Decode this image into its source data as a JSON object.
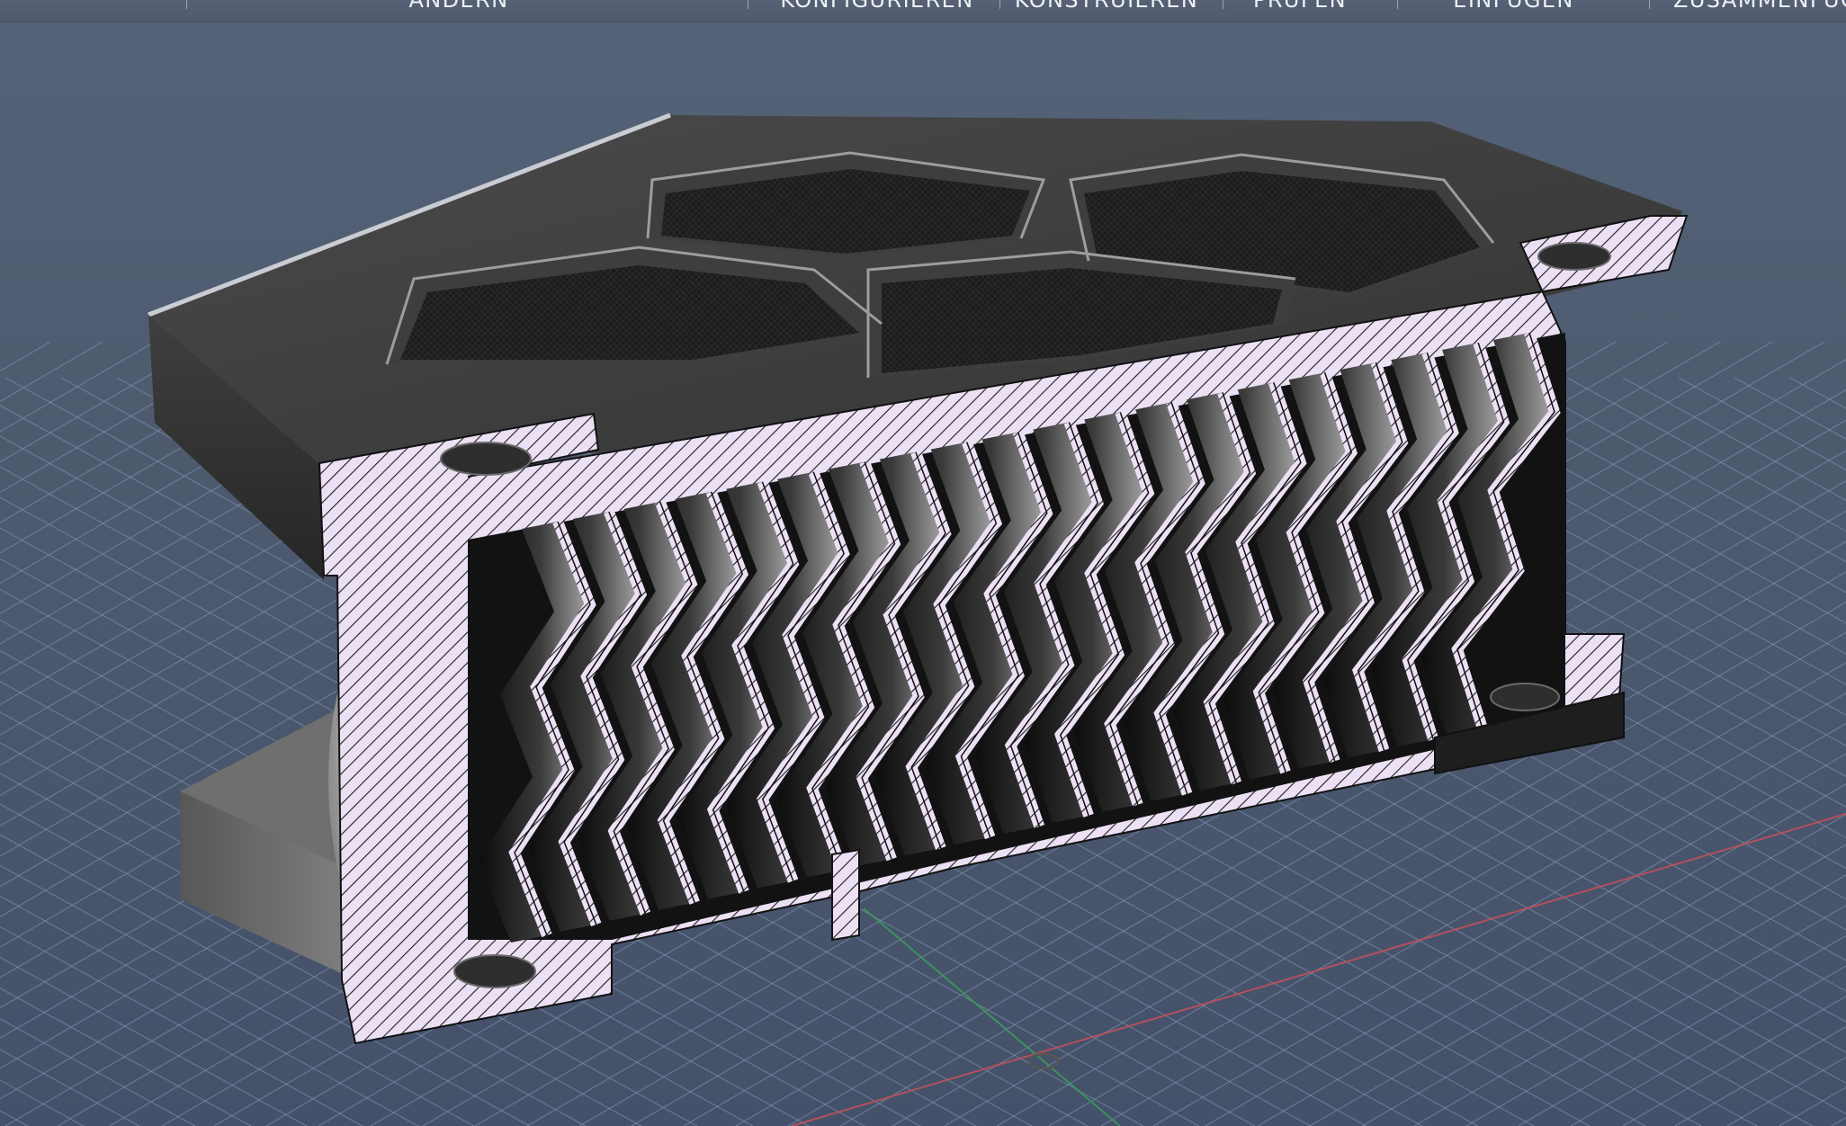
{
  "toolbar": {
    "groups": [
      {
        "label": "ÄNDERN"
      },
      {
        "label": "KONFIGURIEREN"
      },
      {
        "label": "KONSTRUIEREN"
      },
      {
        "label": "PRÜFEN"
      },
      {
        "label": "EINFÜGEN"
      },
      {
        "label": "ZUSAMMENFÜGEN"
      }
    ]
  },
  "viewport": {
    "background_color": "#4a586c",
    "grid_color": "#7f92ad",
    "section_hatch_color": "#e8d8f2",
    "model_color": "#3c3c3c",
    "x_axis_color": "#c0505a",
    "y_axis_color": "#3a9a5a"
  }
}
